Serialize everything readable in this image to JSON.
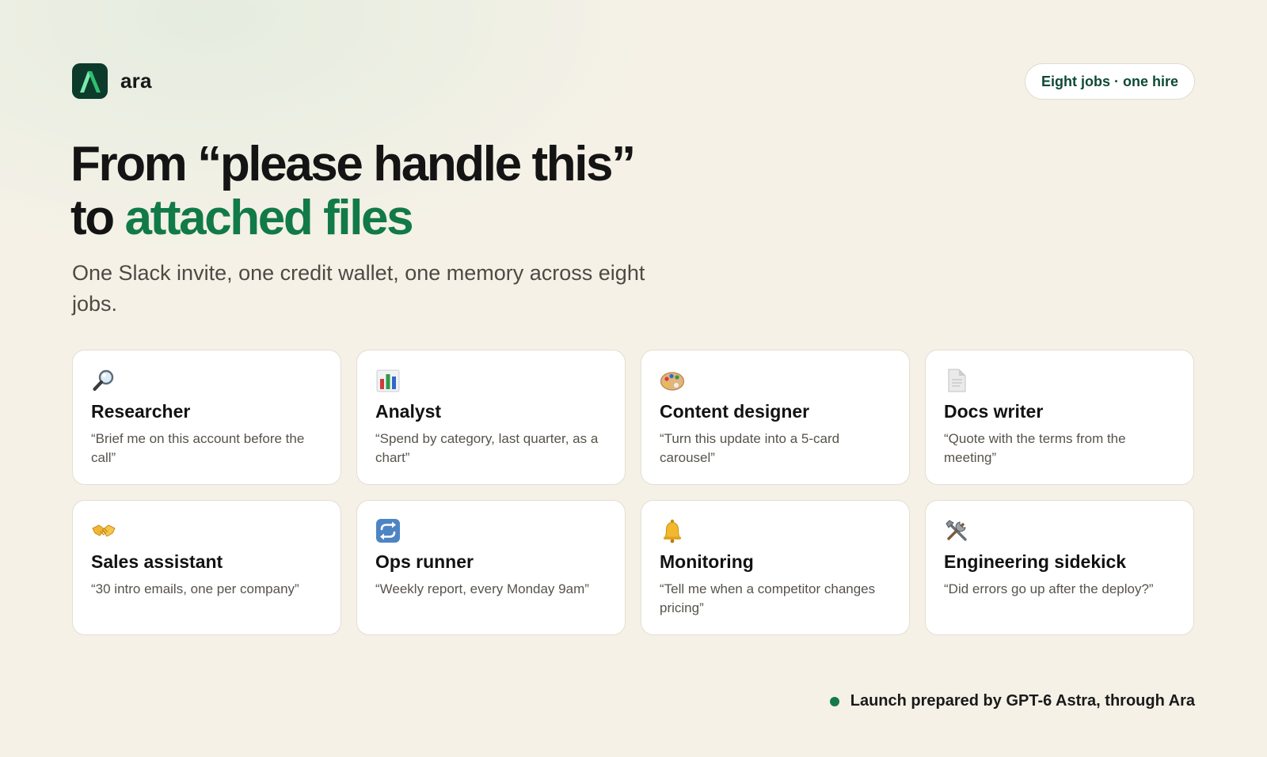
{
  "brand": {
    "name": "ara",
    "logo_icon": "ara-logo-icon"
  },
  "badge": {
    "label": "Eight jobs · one hire"
  },
  "hero": {
    "headline_line1": "From “please handle this”",
    "headline_line2_prefix": "to ",
    "headline_line2_accent": "attached files",
    "subhead": "One Slack invite, one credit wallet, one memory across eight jobs."
  },
  "jobs": [
    {
      "icon": "magnifying-glass-icon",
      "title": "Researcher",
      "prompt": "“Brief me on this account before the call”"
    },
    {
      "icon": "bar-chart-icon",
      "title": "Analyst",
      "prompt": "“Spend by category, last quarter, as a chart”"
    },
    {
      "icon": "palette-icon",
      "title": "Content designer",
      "prompt": "“Turn this update into a 5-card carousel”"
    },
    {
      "icon": "document-icon",
      "title": "Docs writer",
      "prompt": "“Quote with the terms from the meeting”"
    },
    {
      "icon": "handshake-icon",
      "title": "Sales assistant",
      "prompt": "“30 intro emails, one per company”"
    },
    {
      "icon": "repeat-icon",
      "title": "Ops runner",
      "prompt": "“Weekly report, every Monday 9am”"
    },
    {
      "icon": "bell-icon",
      "title": "Monitoring",
      "prompt": "“Tell me when a competitor changes pricing”"
    },
    {
      "icon": "tools-icon",
      "title": "Engineering sidekick",
      "prompt": "“Did errors go up after the deploy?”"
    }
  ],
  "footer": {
    "label": "Launch prepared by GPT-6 Astra, through Ara",
    "status_icon": "status-dot-icon"
  },
  "colors": {
    "background": "#f5f1e7",
    "accent": "#117a47",
    "brand_dark": "#0c3b2c",
    "card": "#ffffff"
  }
}
